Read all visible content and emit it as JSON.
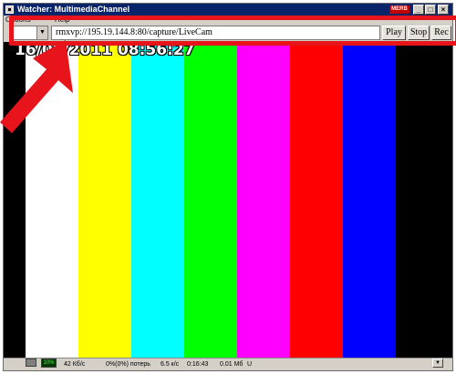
{
  "window": {
    "title": "Watcher: MultimediaChannel",
    "badge": "MERB",
    "controls": {
      "minimize": "_",
      "maximize": "□",
      "close": "×"
    }
  },
  "menu": {
    "items": [
      "Options",
      "Help"
    ]
  },
  "toolbar": {
    "url_value": "rmxvp://195.19.144.8:80/capture/LiveCam",
    "play_label": "Play",
    "stop_label": "Stop",
    "rec_label": "Rec",
    "combo_arrow": "▼"
  },
  "video": {
    "timestamp": "16/08/2011 08:56:27",
    "bars": [
      "#ffffff",
      "#ffff00",
      "#00ffff",
      "#00ff00",
      "#ff00ff",
      "#ff0000",
      "#0000ff",
      "#000000"
    ]
  },
  "status": {
    "volume": "10%",
    "rate": "42 Кб/с",
    "loss": "0%(0%) потерь",
    "fps": "6.5 к/с",
    "time": "0:16:43",
    "size": "0.01 Мб",
    "flag": "U",
    "dropdown_arrow": "▼"
  },
  "annotation": {
    "color": "#e8141b"
  }
}
